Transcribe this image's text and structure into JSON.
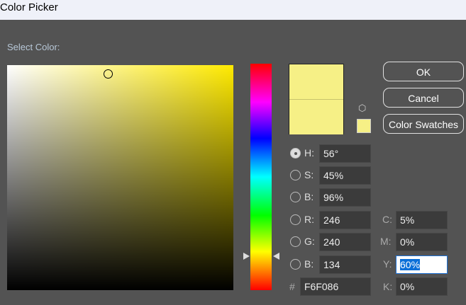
{
  "window": {
    "title": "Color Picker"
  },
  "select_label": "Select Color:",
  "current_color": "#F6F086",
  "buttons": {
    "ok": "OK",
    "cancel": "Cancel",
    "swatches": "Color Swatches"
  },
  "hsb": {
    "h_label": "H:",
    "h": "56°",
    "s_label": "S:",
    "s": "45%",
    "b_label": "B:",
    "b": "96%"
  },
  "rgb": {
    "r_label": "R:",
    "r": "246",
    "g_label": "G:",
    "g": "240",
    "b_label": "B:",
    "b": "134"
  },
  "hex": {
    "label": "#",
    "value": "F6F086"
  },
  "cmyk": {
    "c_label": "C:",
    "c": "5%",
    "m_label": "M:",
    "m": "0%",
    "y_label": "Y:",
    "y": "60%",
    "k_label": "K:",
    "k": "0%"
  }
}
